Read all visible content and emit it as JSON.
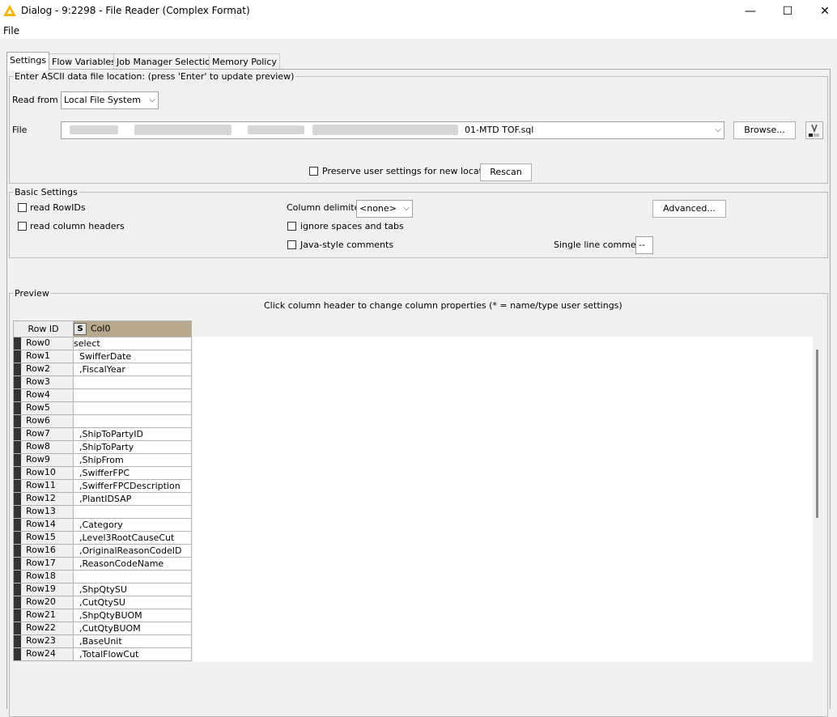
{
  "window": {
    "title": "Dialog - 9:2298 - File Reader (Complex Format)",
    "minimize": "—",
    "maximize": "☐",
    "close": "✕",
    "icon": "knime-warning-triangle-icon"
  },
  "menu": {
    "file": "File"
  },
  "tabs": [
    {
      "label": "Settings"
    },
    {
      "label": "Flow Variables"
    },
    {
      "label": "Job Manager Selection"
    },
    {
      "label": "Memory Policy"
    }
  ],
  "location": {
    "legend": "Enter ASCII data file location: (press 'Enter' to update preview)",
    "read_from_label": "Read from",
    "read_from_value": "Local File System",
    "file_label": "File",
    "file_value": "01-MTD TOF.sql",
    "browse": "Browse...",
    "preserve_label": "Preserve user settings for new location",
    "rescan": "Rescan"
  },
  "basic": {
    "legend": "Basic Settings",
    "read_rowids": "read RowIDs",
    "read_headers": "read column headers",
    "delimiter_label": "Column delimiter:",
    "delimiter_value": "<none>",
    "ignore_spaces": "ignore spaces and tabs",
    "java_comments": "Java-style comments",
    "advanced": "Advanced...",
    "single_line_label": "Single line comment:",
    "single_line_value": "--"
  },
  "preview": {
    "legend": "Preview",
    "hint": "Click column header to change column properties (* = name/type user settings)",
    "rowid_header": "Row ID",
    "col_type": "S",
    "col_header": "Col0",
    "rows": [
      {
        "id": "Row0",
        "value": "select"
      },
      {
        "id": "Row1",
        "value": "  SwifferDate"
      },
      {
        "id": "Row2",
        "value": "  ,FiscalYear"
      },
      {
        "id": "Row3",
        "value": ""
      },
      {
        "id": "Row4",
        "value": ""
      },
      {
        "id": "Row5",
        "value": ""
      },
      {
        "id": "Row6",
        "value": ""
      },
      {
        "id": "Row7",
        "value": "  ,ShipToPartyID"
      },
      {
        "id": "Row8",
        "value": "  ,ShipToParty"
      },
      {
        "id": "Row9",
        "value": "  ,ShipFrom"
      },
      {
        "id": "Row10",
        "value": "  ,SwifferFPC"
      },
      {
        "id": "Row11",
        "value": "  ,SwifferFPCDescription"
      },
      {
        "id": "Row12",
        "value": "  ,PlantIDSAP"
      },
      {
        "id": "Row13",
        "value": ""
      },
      {
        "id": "Row14",
        "value": "  ,Category"
      },
      {
        "id": "Row15",
        "value": "  ,Level3RootCauseCut"
      },
      {
        "id": "Row16",
        "value": "  ,OriginalReasonCodeID"
      },
      {
        "id": "Row17",
        "value": "  ,ReasonCodeName"
      },
      {
        "id": "Row18",
        "value": ""
      },
      {
        "id": "Row19",
        "value": "  ,ShpQtySU"
      },
      {
        "id": "Row20",
        "value": "  ,CutQtySU"
      },
      {
        "id": "Row21",
        "value": "  ,ShpQtyBUOM"
      },
      {
        "id": "Row22",
        "value": "  ,CutQtyBUOM"
      },
      {
        "id": "Row23",
        "value": "  ,BaseUnit"
      },
      {
        "id": "Row24",
        "value": "  ,TotalFlowCut"
      }
    ]
  }
}
